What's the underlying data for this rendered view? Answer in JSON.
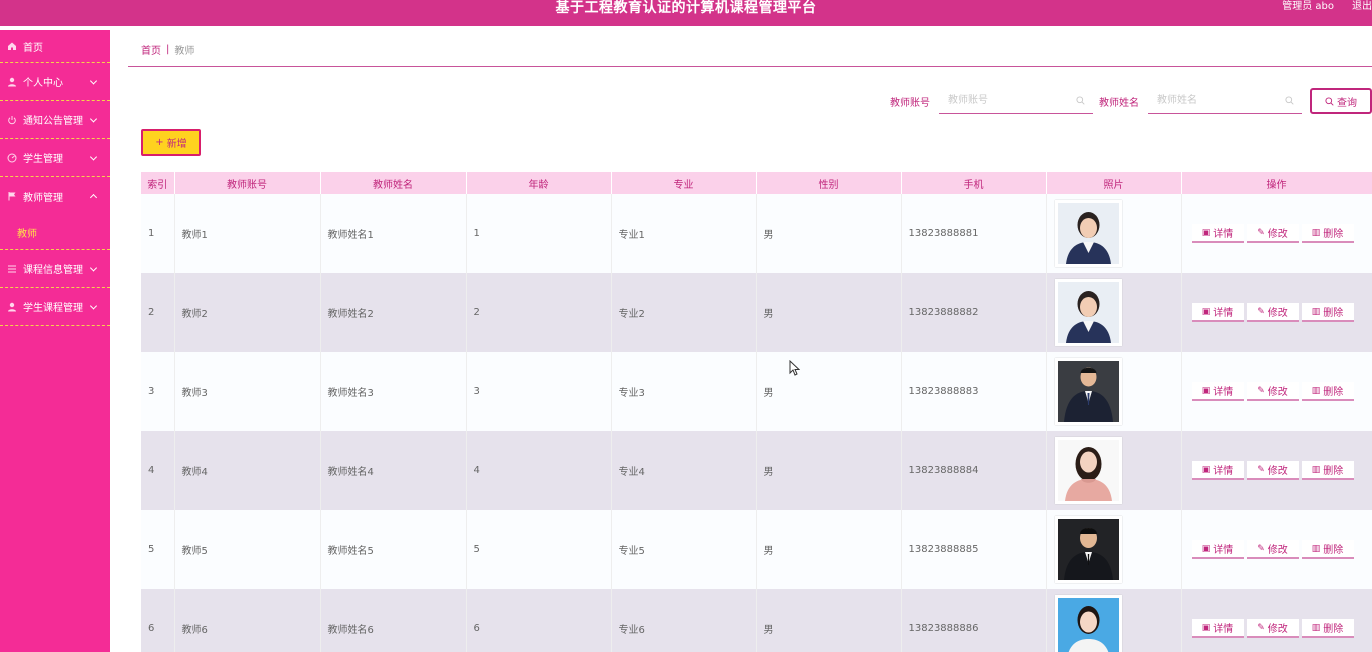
{
  "app": {
    "title": "基于工程教育认证的计算机课程管理平台",
    "user": "管理员 abo",
    "logout": "退出"
  },
  "sidebar": {
    "items": [
      {
        "label": "首页",
        "icon": "home-icon"
      },
      {
        "label": "个人中心",
        "icon": "person-icon"
      },
      {
        "label": "通知公告管理",
        "icon": "power-icon"
      },
      {
        "label": "学生管理",
        "icon": "gauge-icon"
      },
      {
        "label": "教师管理",
        "icon": "flag-icon"
      },
      {
        "label": "课程信息管理",
        "icon": "list-icon"
      },
      {
        "label": "学生课程管理",
        "icon": "person-icon"
      }
    ],
    "active_sub": "教师"
  },
  "breadcrumb": {
    "home": "首页",
    "separator": "|",
    "current": "教师"
  },
  "search": {
    "account_label": "教师账号",
    "account_placeholder": "教师账号",
    "name_label": "教师姓名",
    "name_placeholder": "教师姓名",
    "query": "查询"
  },
  "add_button": "新增",
  "table": {
    "columns": [
      "索引",
      "教师账号",
      "教师姓名",
      "年龄",
      "专业",
      "性别",
      "手机",
      "照片",
      "操作"
    ],
    "rows": [
      {
        "idx": "1",
        "account": "教师1",
        "name": "教师姓名1",
        "age": "1",
        "major": "专业1",
        "gender": "男",
        "phone": "13823888881"
      },
      {
        "idx": "2",
        "account": "教师2",
        "name": "教师姓名2",
        "age": "2",
        "major": "专业2",
        "gender": "男",
        "phone": "13823888882"
      },
      {
        "idx": "3",
        "account": "教师3",
        "name": "教师姓名3",
        "age": "3",
        "major": "专业3",
        "gender": "男",
        "phone": "13823888883"
      },
      {
        "idx": "4",
        "account": "教师4",
        "name": "教师姓名4",
        "age": "4",
        "major": "专业4",
        "gender": "男",
        "phone": "13823888884"
      },
      {
        "idx": "5",
        "account": "教师5",
        "name": "教师姓名5",
        "age": "5",
        "major": "专业5",
        "gender": "男",
        "phone": "13823888885"
      },
      {
        "idx": "6",
        "account": "教师6",
        "name": "教师姓名6",
        "age": "6",
        "major": "专业6",
        "gender": "男",
        "phone": "13823888886"
      }
    ],
    "ops": {
      "detail": "详情",
      "edit": "修改",
      "delete": "删除"
    }
  },
  "colors": {
    "header": "#d3338a",
    "sidebar": "#f42c96",
    "accent": "#c0267c",
    "add_button": "#ffd21f"
  }
}
